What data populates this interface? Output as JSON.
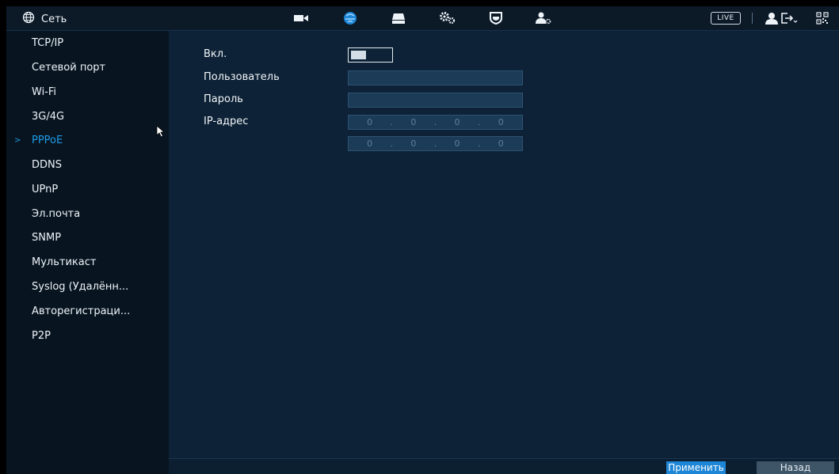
{
  "header": {
    "title": "Сеть",
    "title_icon": "globe-icon",
    "nav_icons": [
      "camera-icon",
      "network-icon",
      "storage-icon",
      "system-settings-icon",
      "security-shield-icon",
      "account-settings-icon"
    ],
    "live_label": "LIVE",
    "right_icons": [
      "user-icon",
      "logout-icon",
      "qr-code-icon"
    ]
  },
  "sidebar": {
    "items": [
      {
        "label": "TCP/IP"
      },
      {
        "label": "Сетевой порт"
      },
      {
        "label": "Wi-Fi"
      },
      {
        "label": "3G/4G"
      },
      {
        "label": "PPPoE",
        "active": true
      },
      {
        "label": "DDNS"
      },
      {
        "label": "UPnP"
      },
      {
        "label": "Эл.почта"
      },
      {
        "label": "SNMP"
      },
      {
        "label": "Мультикаст"
      },
      {
        "label": "Syslog (Удалённ..."
      },
      {
        "label": "Авторегистраци..."
      },
      {
        "label": "P2P"
      }
    ],
    "active_marker": ">"
  },
  "form": {
    "enable_label": "Вкл.",
    "enable_value": false,
    "user_label": "Пользователь",
    "user_value": "",
    "password_label": "Пароль",
    "password_value": "",
    "ip_label": "IP-адрес",
    "ip_octets": [
      "0",
      "0",
      "0",
      "0"
    ],
    "ip2_octets": [
      "0",
      "0",
      "0",
      "0"
    ]
  },
  "footer": {
    "apply_label": "Применить",
    "back_label": "Назад"
  },
  "colors": {
    "accent": "#1e86d6",
    "active_text": "#1e9be6",
    "background": "#0d2236",
    "sidebar": "#081521"
  }
}
